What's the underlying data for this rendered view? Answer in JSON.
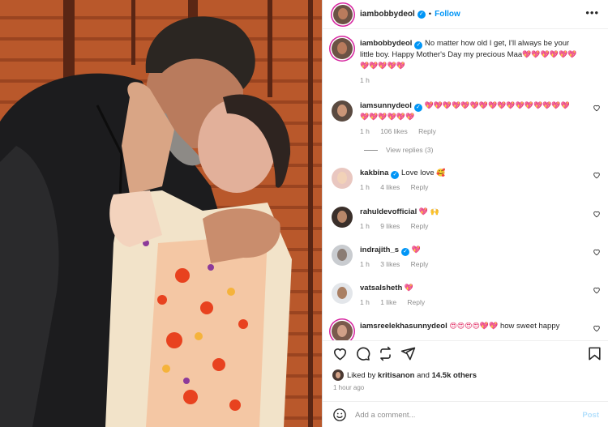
{
  "post": {
    "username": "iambobbydeol",
    "follow_label": "Follow",
    "dot": "•",
    "more": "•••"
  },
  "caption": {
    "username": "iambobbydeol",
    "text": "No matter how old I get, I'll always be your little boy. Happy Mother's Day my precious Maa",
    "emojis": "💖💖💖💖💖💖💖💖💖💖💖",
    "time": "1 h"
  },
  "comments": [
    {
      "username": "iamsunnydeol",
      "text": "",
      "emojis": "💖💖💖💖💖💖💖💖💖💖💖💖💖💖💖💖💖💖💖💖💖💖",
      "time": "1 h",
      "likes": "106 likes",
      "reply": "Reply",
      "verified": true
    },
    {
      "username": "kakbina",
      "text": "Love love",
      "emojis": "🥰",
      "time": "1 h",
      "likes": "4 likes",
      "reply": "Reply",
      "verified": true
    },
    {
      "username": "rahuldevofficial",
      "text": "",
      "emojis": "💖 🙌",
      "time": "1 h",
      "likes": "9 likes",
      "reply": "Reply",
      "verified": false
    },
    {
      "username": "indrajith_s",
      "text": "",
      "emojis": "💖",
      "time": "1 h",
      "likes": "3 likes",
      "reply": "Reply",
      "verified": true
    },
    {
      "username": "vatsalsheth",
      "text": "",
      "emojis": "💖",
      "time": "1 h",
      "likes": "1 like",
      "reply": "Reply",
      "verified": false
    },
    {
      "username": "iamsreelekhasunnydeol",
      "text": "how sweet happy",
      "emojis": "😍😍😍😍💖💖",
      "time": "1 h",
      "likes": "",
      "reply": "",
      "verified": false
    }
  ],
  "view_replies": "View replies (3)",
  "likes_line": {
    "prefix": "Liked by",
    "user": "kritisanon",
    "and": "and",
    "others": "14.5k others"
  },
  "post_time": "1 hour ago",
  "add_comment": {
    "placeholder": "Add a comment...",
    "post_label": "Post"
  },
  "colors": {
    "accent": "#0095f6",
    "heart": "#e0245e",
    "muted": "#8e8e8e",
    "post_disabled": "#b2dffc"
  },
  "icons": [
    "heart-icon",
    "comment-icon",
    "share-icon",
    "save-icon",
    "smiley-icon",
    "verified-badge",
    "more-options-icon"
  ]
}
